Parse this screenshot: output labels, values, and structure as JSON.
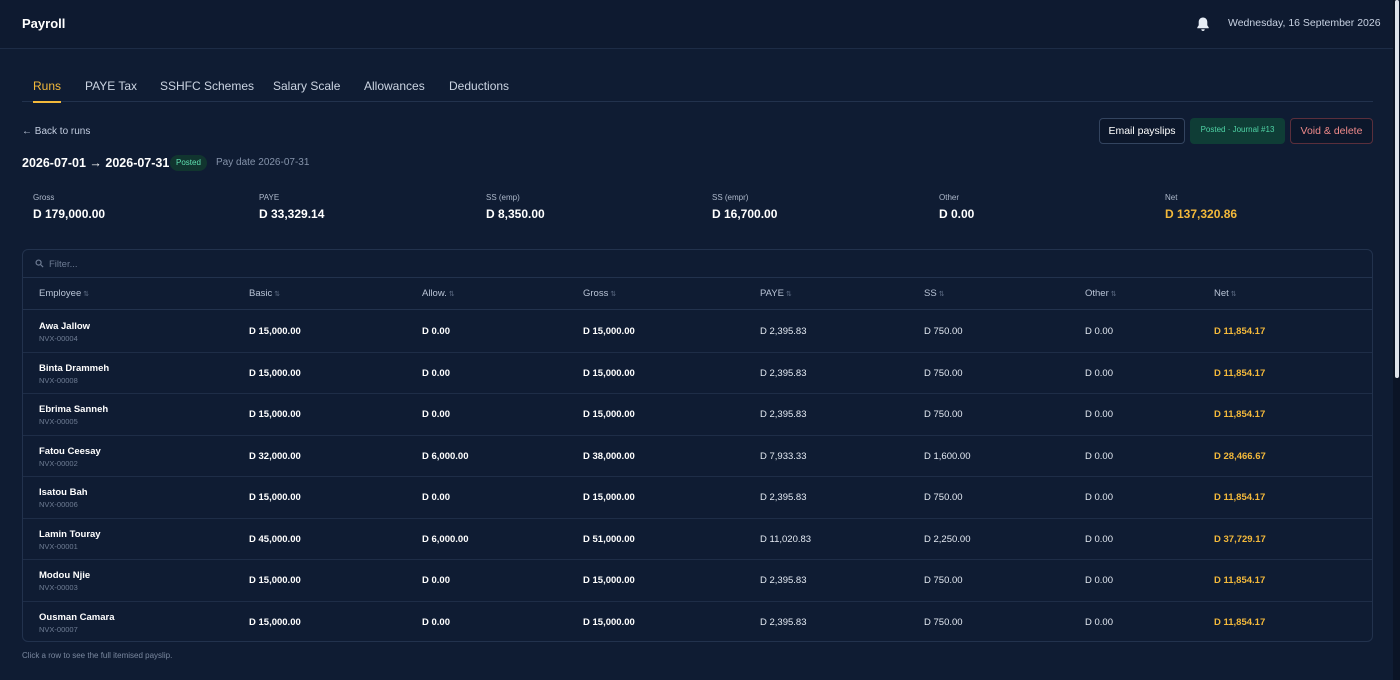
{
  "app": {
    "title": "Payroll",
    "date": "Wednesday, 16 September 2026"
  },
  "tabs": [
    {
      "label": "Runs",
      "active": true
    },
    {
      "label": "PAYE Tax",
      "active": false
    },
    {
      "label": "SSHFC Schemes",
      "active": false
    },
    {
      "label": "Salary Scale",
      "active": false
    },
    {
      "label": "Allowances",
      "active": false
    },
    {
      "label": "Deductions",
      "active": false
    }
  ],
  "run": {
    "back_label": "← Back to runs",
    "period": "2026-07-01 → 2026-07-31",
    "status": "Posted",
    "pay_date": "Pay date 2026-07-31",
    "email_label": "Email payslips",
    "journal_badge": "Posted · Journal #13",
    "void_label": "Void & delete"
  },
  "summary": [
    {
      "label": "Gross",
      "value": "D 179,000.00"
    },
    {
      "label": "PAYE",
      "value": "D 33,329.14"
    },
    {
      "label": "SS (emp)",
      "value": "D 8,350.00"
    },
    {
      "label": "SS (empr)",
      "value": "D 16,700.00"
    },
    {
      "label": "Other",
      "value": "D 0.00"
    },
    {
      "label": "Net",
      "value": "D 137,320.86"
    }
  ],
  "filter": {
    "placeholder": "Filter..."
  },
  "columns": [
    "Employee",
    "Basic",
    "Allow.",
    "Gross",
    "PAYE",
    "SS",
    "Other",
    "Net"
  ],
  "rows": [
    {
      "name": "Awa Jallow",
      "id": "NVX-00004",
      "basic": "D 15,000.00",
      "allow": "D 0.00",
      "gross": "D 15,000.00",
      "paye": "D 2,395.83",
      "ss": "D 750.00",
      "other": "D 0.00",
      "net": "D 11,854.17"
    },
    {
      "name": "Binta Drammeh",
      "id": "NVX-00008",
      "basic": "D 15,000.00",
      "allow": "D 0.00",
      "gross": "D 15,000.00",
      "paye": "D 2,395.83",
      "ss": "D 750.00",
      "other": "D 0.00",
      "net": "D 11,854.17"
    },
    {
      "name": "Ebrima Sanneh",
      "id": "NVX-00005",
      "basic": "D 15,000.00",
      "allow": "D 0.00",
      "gross": "D 15,000.00",
      "paye": "D 2,395.83",
      "ss": "D 750.00",
      "other": "D 0.00",
      "net": "D 11,854.17"
    },
    {
      "name": "Fatou Ceesay",
      "id": "NVX-00002",
      "basic": "D 32,000.00",
      "allow": "D 6,000.00",
      "gross": "D 38,000.00",
      "paye": "D 7,933.33",
      "ss": "D 1,600.00",
      "other": "D 0.00",
      "net": "D 28,466.67"
    },
    {
      "name": "Isatou Bah",
      "id": "NVX-00006",
      "basic": "D 15,000.00",
      "allow": "D 0.00",
      "gross": "D 15,000.00",
      "paye": "D 2,395.83",
      "ss": "D 750.00",
      "other": "D 0.00",
      "net": "D 11,854.17"
    },
    {
      "name": "Lamin Touray",
      "id": "NVX-00001",
      "basic": "D 45,000.00",
      "allow": "D 6,000.00",
      "gross": "D 51,000.00",
      "paye": "D 11,020.83",
      "ss": "D 2,250.00",
      "other": "D 0.00",
      "net": "D 37,729.17"
    },
    {
      "name": "Modou Njie",
      "id": "NVX-00003",
      "basic": "D 15,000.00",
      "allow": "D 0.00",
      "gross": "D 15,000.00",
      "paye": "D 2,395.83",
      "ss": "D 750.00",
      "other": "D 0.00",
      "net": "D 11,854.17"
    },
    {
      "name": "Ousman Camara",
      "id": "NVX-00007",
      "basic": "D 15,000.00",
      "allow": "D 0.00",
      "gross": "D 15,000.00",
      "paye": "D 2,395.83",
      "ss": "D 750.00",
      "other": "D 0.00",
      "net": "D 11,854.17"
    }
  ],
  "footer_note": "Click a row to see the full itemised payslip.",
  "icons": {
    "bell": "bell-icon",
    "search": "search-icon",
    "sort": "sort-icon"
  },
  "colors": {
    "accent": "#f3b93b",
    "posted": "#4fd3a5",
    "danger": "#ef8a8a",
    "background": "#0f1c33"
  }
}
